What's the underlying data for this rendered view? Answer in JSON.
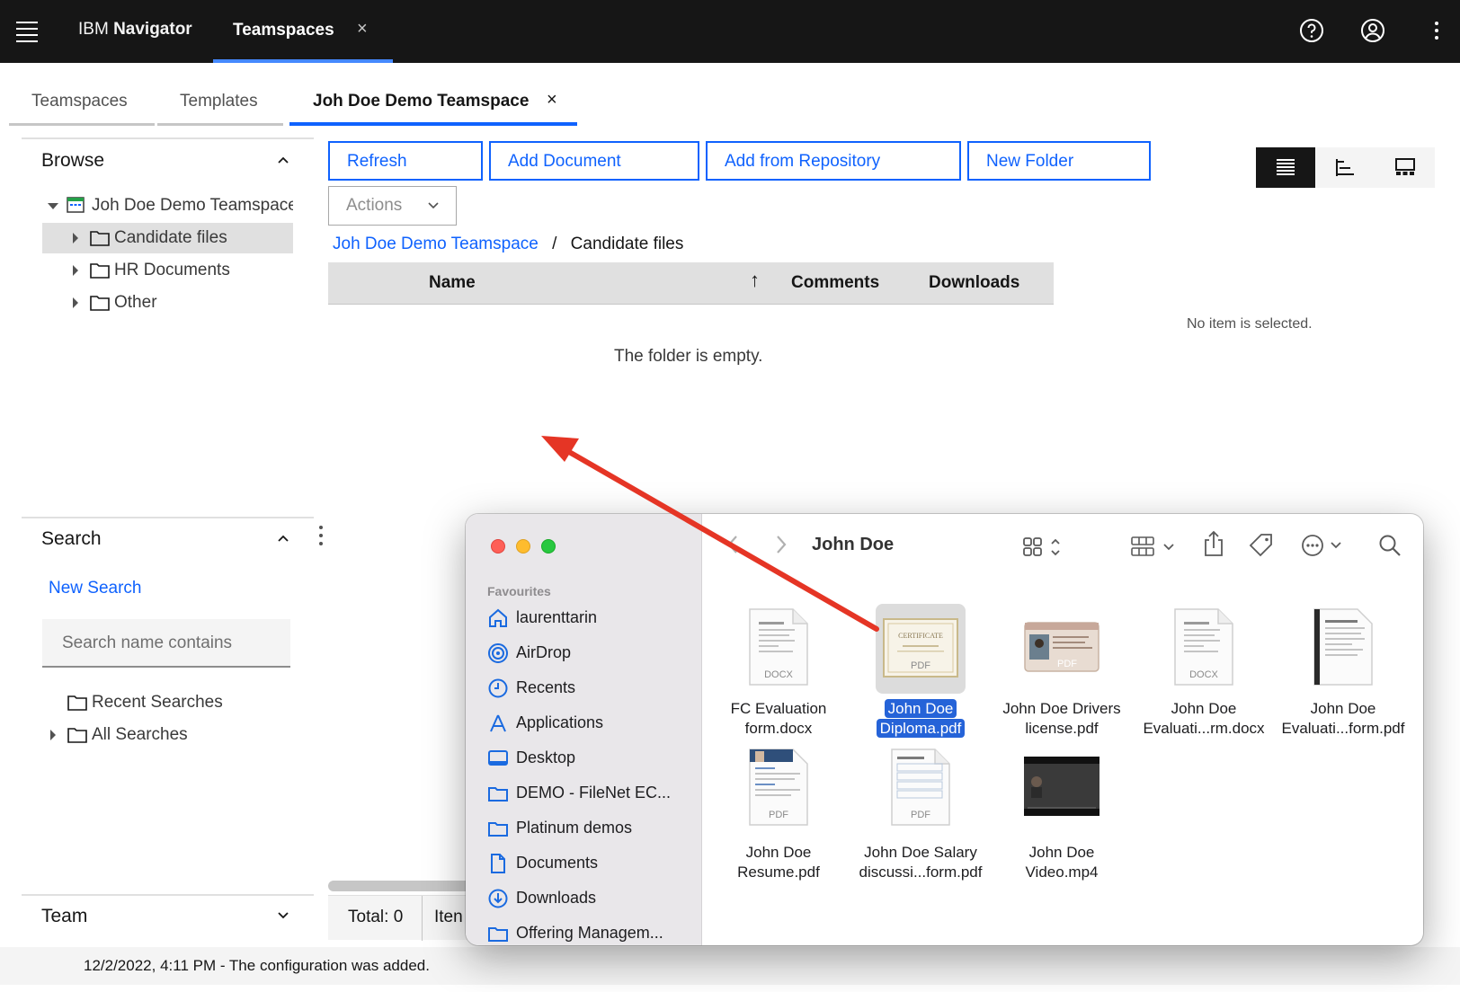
{
  "topbar": {
    "brand_prefix": "IBM",
    "brand_name": "Navigator",
    "tab_label": "Teamspaces",
    "tab_close": "×"
  },
  "tabs": [
    {
      "label": "Teamspaces"
    },
    {
      "label": "Templates"
    },
    {
      "label": "Joh Doe Demo Teamspace",
      "close": "×"
    }
  ],
  "browse": {
    "title": "Browse",
    "root": "Joh Doe Demo Teamspace",
    "items": [
      {
        "label": "Candidate files"
      },
      {
        "label": "HR Documents"
      },
      {
        "label": "Other"
      }
    ]
  },
  "search": {
    "title": "Search",
    "new_search": "New Search",
    "placeholder": "Search name contains",
    "recent": "Recent Searches",
    "all": "All Searches"
  },
  "team": {
    "title": "Team"
  },
  "toolbar": {
    "refresh": "Refresh",
    "add_document": "Add Document",
    "add_from_repository": "Add from Repository",
    "new_folder": "New Folder",
    "actions": "Actions"
  },
  "breadcrumb": {
    "root": "Joh Doe Demo Teamspace",
    "sep": "/",
    "current": "Candidate files"
  },
  "grid": {
    "columns": [
      "Name",
      "Comments",
      "Downloads"
    ],
    "sort_indicator": "↑",
    "empty": "The folder is empty.",
    "no_selection": "No item is selected."
  },
  "footer": {
    "total": "Total: 0",
    "items": "Iten"
  },
  "status": {
    "message": "12/2/2022, 4:11 PM - The configuration was added."
  },
  "colors": {
    "accent": "#0f62fe",
    "topbar": "#161616",
    "arrow": "#e53525",
    "finder_selection": "#2563d8"
  },
  "finder": {
    "title": "John Doe",
    "favourites_label": "Favourites",
    "sidebar": [
      {
        "label": "laurenttarin",
        "icon": "home-icon"
      },
      {
        "label": "AirDrop",
        "icon": "airdrop-icon"
      },
      {
        "label": "Recents",
        "icon": "clock-icon"
      },
      {
        "label": "Applications",
        "icon": "applications-icon"
      },
      {
        "label": "Desktop",
        "icon": "desktop-icon"
      },
      {
        "label": "DEMO - FileNet EC...",
        "icon": "folder-icon"
      },
      {
        "label": "Platinum demos",
        "icon": "folder-icon"
      },
      {
        "label": "Documents",
        "icon": "document-icon"
      },
      {
        "label": "Downloads",
        "icon": "download-icon"
      },
      {
        "label": "Offering Managem...",
        "icon": "folder-icon"
      }
    ],
    "files": [
      {
        "line1": "FC Evaluation",
        "line2": "form.docx",
        "badge": "DOCX"
      },
      {
        "line1": "John Doe",
        "line2": "Diploma.pdf",
        "badge": "PDF",
        "selected": true
      },
      {
        "line1": "John Doe Drivers",
        "line2": "license.pdf",
        "badge": "PDF"
      },
      {
        "line1": "John Doe",
        "line2": "Evaluati...rm.docx",
        "badge": "DOCX"
      },
      {
        "line1": "John Doe",
        "line2": "Evaluati...form.pdf",
        "badge": ""
      },
      {
        "line1": "John Doe",
        "line2": "Resume.pdf",
        "badge": "PDF"
      },
      {
        "line1": "John Doe Salary",
        "line2": "discussi...form.pdf",
        "badge": "PDF"
      },
      {
        "line1": "John Doe",
        "line2": "Video.mp4",
        "badge": ""
      }
    ]
  }
}
